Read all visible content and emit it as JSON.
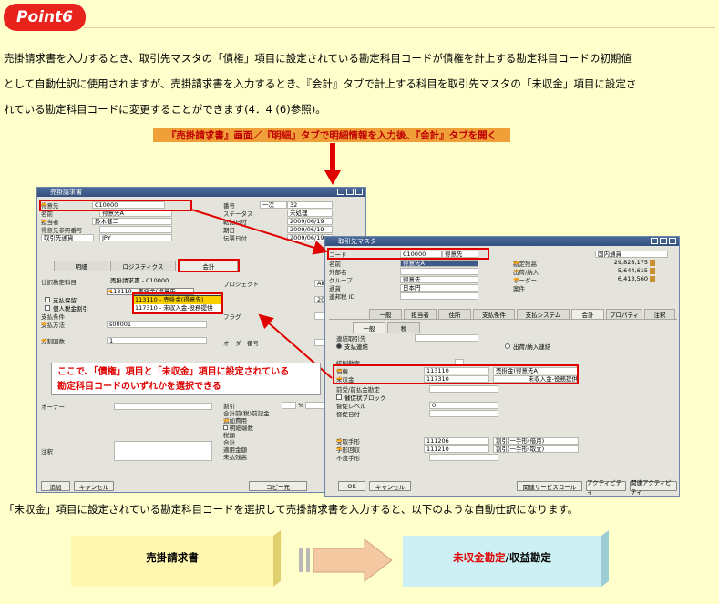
{
  "header": {
    "point_label": "Point6"
  },
  "paragraph": {
    "line1": "売掛請求書を入力するとき、取引先マスタの「債権」項目に設定されている勘定科目コードが債権を計上する勘定科目コードの初期値",
    "line2": "として自動仕訳に使用されますが、売掛請求書を入力するとき、『会計』タブで計上する科目を取引先マスタの「未収金」項目に設定さ",
    "line3": "れている勘定科目コードに変更することができます(4．4 (6)参照)。"
  },
  "instruction": "『売掛請求書』画面／『明細』タブで明細情報を入力後、『会計』タブを開く",
  "invoice_window": {
    "title": "売掛請求書",
    "fields": [
      {
        "label": "得意先",
        "value": "C10000"
      },
      {
        "label": "名前",
        "value": "得意先A"
      },
      {
        "label": "担当者",
        "value": "鈴木健二"
      },
      {
        "label": "得意先参照番号",
        "value": ""
      },
      {
        "label": "取引先通貨",
        "value": "JPY"
      }
    ],
    "right_fields": [
      {
        "label": "番号",
        "value": "一次",
        "value2": "32"
      },
      {
        "label": "ステータス",
        "value": "未処理"
      },
      {
        "label": "転記日付",
        "value": "2009/06/19"
      },
      {
        "label": "期日",
        "value": "2009/06/19"
      },
      {
        "label": "伝票日付",
        "value": "2009/06/19"
      }
    ],
    "tabs": [
      "明細",
      "ロジスティクス",
      "会計"
    ],
    "account_label": "仕訳勘定科目",
    "account_value": "売掛請求書 - C10000",
    "dropdown_items": [
      "113110 - 売掛金(得意先)",
      "117310 - 未収入金-役務提供"
    ],
    "dropdown_selected": "113110 - 売掛金(得意先",
    "checkboxes": [
      "支払保留",
      "個人税金割引"
    ],
    "pay_terms_label": "支払条件",
    "pay_method_label": "支払方法",
    "pay_method_value": "s00001",
    "installments_label": "分割回数",
    "installments_value": "1",
    "project_label": "プロジェクト",
    "project_value": "AⅢ SAP Busi",
    "date_label": "",
    "date_value": "2009/06/19",
    "flag_label": "フラグ",
    "order_label": "オーダー番号",
    "owner_label": "オーナー",
    "remarks_label": "注釈",
    "totals": [
      "割引",
      "合計前(税)前記金",
      "追加費用",
      "明細端数",
      "税額",
      "合計",
      "適用金額",
      "未払残高"
    ],
    "pct_symbol": "%",
    "btn_add": "追加",
    "btn_cancel": "キャンセル",
    "btn_copy": "コピー元"
  },
  "bp_window": {
    "title": "取引先マスタ",
    "fields": [
      {
        "label": "コード",
        "value": "C10000",
        "value2": "得意先"
      },
      {
        "label": "名前",
        "value": "得意先A"
      },
      {
        "label": "外部名",
        "value": ""
      },
      {
        "label": "グループ",
        "value": "得意先"
      },
      {
        "label": "通貨",
        "value": "日本円"
      },
      {
        "label": "連邦税 ID",
        "value": ""
      }
    ],
    "currency_select": "国内通貨",
    "balances": [
      {
        "label": "勘定残高",
        "value": "29,828,175"
      },
      {
        "label": "出荷/納入",
        "value": "5,644,615"
      },
      {
        "label": "オーダー",
        "value": "6,413,560"
      },
      {
        "label": "案件",
        "value": ""
      }
    ],
    "tabs": [
      "一般",
      "担当者",
      "住所",
      "支払条件",
      "支払システム",
      "会計",
      "プロパティ",
      "注釈"
    ],
    "subtabs": [
      "一般",
      "税"
    ],
    "consolidation_label": "連結取引先",
    "radio1": "支払連結",
    "radio2": "出荷/納入連結",
    "control_accounts_label": "統制勘定",
    "receivable_label": "債権",
    "receivable_code": "113110",
    "receivable_name": "売掛金(得意先A)",
    "unreceived_label": "未収金",
    "unreceived_code": "117310",
    "unreceived_name": "未収入金-役務提供",
    "advance_label": "前受/前払金勘定",
    "block_label": "催促状ブロック",
    "dunning_level_label": "督促レベル",
    "dunning_level_value": "0",
    "dunning_date_label": "督促日付",
    "note_receivable_label": "受取手形",
    "note_receivable_code": "111206",
    "note_receivable_name": "割引(一手形(借月)",
    "bill_collection_label": "手形回収",
    "bill_collection_code": "111210",
    "bill_collection_name": "割引(一手形(取立)",
    "unpaid_label": "不渡手形",
    "btn_ok": "OK",
    "btn_cancel": "キャンセル",
    "btn_related_service": "関連サービスコール",
    "btn_activity": "アクティビティ",
    "btn_related_activity": "関連アクティビティ"
  },
  "callout": {
    "line1": "ここで、「債権」項目と「未収金」項目に設定されている",
    "line2": "勘定科目コードのいずれかを選択できる"
  },
  "result_text": "「未収金」項目に設定されている勘定科目コードを選択して売掛請求書を入力すると、以下のような自動仕訳になります。",
  "journal": {
    "left_box": "売掛請求書",
    "right_red": "未収金勘定",
    "right_black": "/収益勘定"
  },
  "colors": {
    "accent_red": "#E8231C",
    "background": "#FFFFCC",
    "window_title": "#3D5A88"
  }
}
